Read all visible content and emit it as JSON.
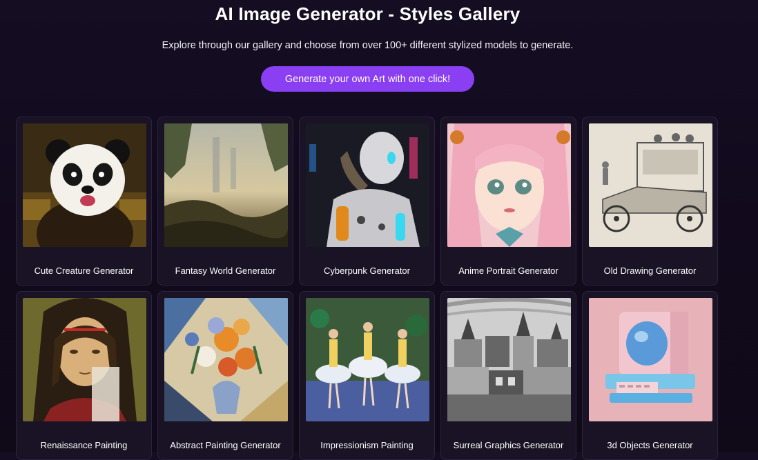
{
  "header": {
    "title": "AI Image Generator - Styles Gallery",
    "subtitle": "Explore through our gallery and choose from over 100+ different stylized models to generate.",
    "cta_label": "Generate your own Art with one click!"
  },
  "gallery": {
    "items": [
      {
        "label": "Cute Creature Generator",
        "image": "panda-image"
      },
      {
        "label": "Fantasy World Generator",
        "image": "fantasy-landscape-image"
      },
      {
        "label": "Cyberpunk Generator",
        "image": "robot-image"
      },
      {
        "label": "Anime Portrait Generator",
        "image": "anime-girl-image"
      },
      {
        "label": "Old Drawing Generator",
        "image": "vintage-car-sketch-image"
      },
      {
        "label": "Renaissance Painting",
        "image": "mona-lisa-image"
      },
      {
        "label": "Abstract Painting Generator",
        "image": "flower-vase-image"
      },
      {
        "label": "Impressionism Painting",
        "image": "ballet-dancers-image"
      },
      {
        "label": "Surreal Graphics Generator",
        "image": "city-sketch-image"
      },
      {
        "label": "3d Objects Generator",
        "image": "retro-computer-image"
      }
    ]
  },
  "colors": {
    "background": "#130b1e",
    "accent": "#8a3ff2",
    "card": "#1a1326",
    "card_border": "#2c2340"
  }
}
